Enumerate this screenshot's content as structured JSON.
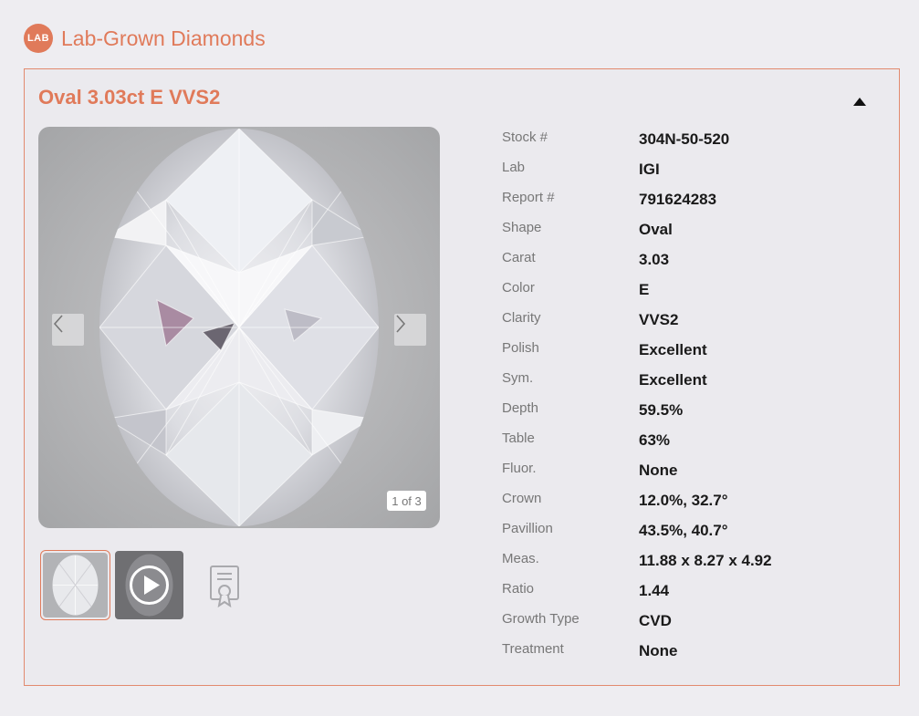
{
  "brand": {
    "logo_text": "LAB",
    "title": "Lab-Grown Diamonds",
    "accent_color": "#e07a5a"
  },
  "product": {
    "title": "Oval 3.03ct E VVS2"
  },
  "viewer": {
    "counter": "1 of 3",
    "prev_icon": "chevron-left-icon",
    "next_icon": "chevron-right-icon"
  },
  "thumbnails": [
    {
      "type": "image",
      "icon": "diamond-thumbnail"
    },
    {
      "type": "video",
      "icon": "play-icon"
    },
    {
      "type": "certificate",
      "icon": "certificate-icon"
    }
  ],
  "specs": [
    {
      "label": "Stock #",
      "value": "304N-50-520"
    },
    {
      "label": "Lab",
      "value": "IGI"
    },
    {
      "label": "Report #",
      "value": "791624283"
    },
    {
      "label": "Shape",
      "value": "Oval"
    },
    {
      "label": "Carat",
      "value": "3.03"
    },
    {
      "label": "Color",
      "value": "E"
    },
    {
      "label": "Clarity",
      "value": "VVS2"
    },
    {
      "label": "Polish",
      "value": "Excellent"
    },
    {
      "label": "Sym.",
      "value": "Excellent"
    },
    {
      "label": "Depth",
      "value": "59.5%"
    },
    {
      "label": "Table",
      "value": "63%"
    },
    {
      "label": "Fluor.",
      "value": "None"
    },
    {
      "label": "Crown",
      "value": "12.0%, 32.7°"
    },
    {
      "label": "Pavillion",
      "value": "43.5%, 40.7°"
    },
    {
      "label": "Meas.",
      "value": "11.88 x 8.27 x 4.92"
    },
    {
      "label": "Ratio",
      "value": "1.44"
    },
    {
      "label": "Growth Type",
      "value": "CVD"
    },
    {
      "label": "Treatment",
      "value": "None"
    }
  ]
}
